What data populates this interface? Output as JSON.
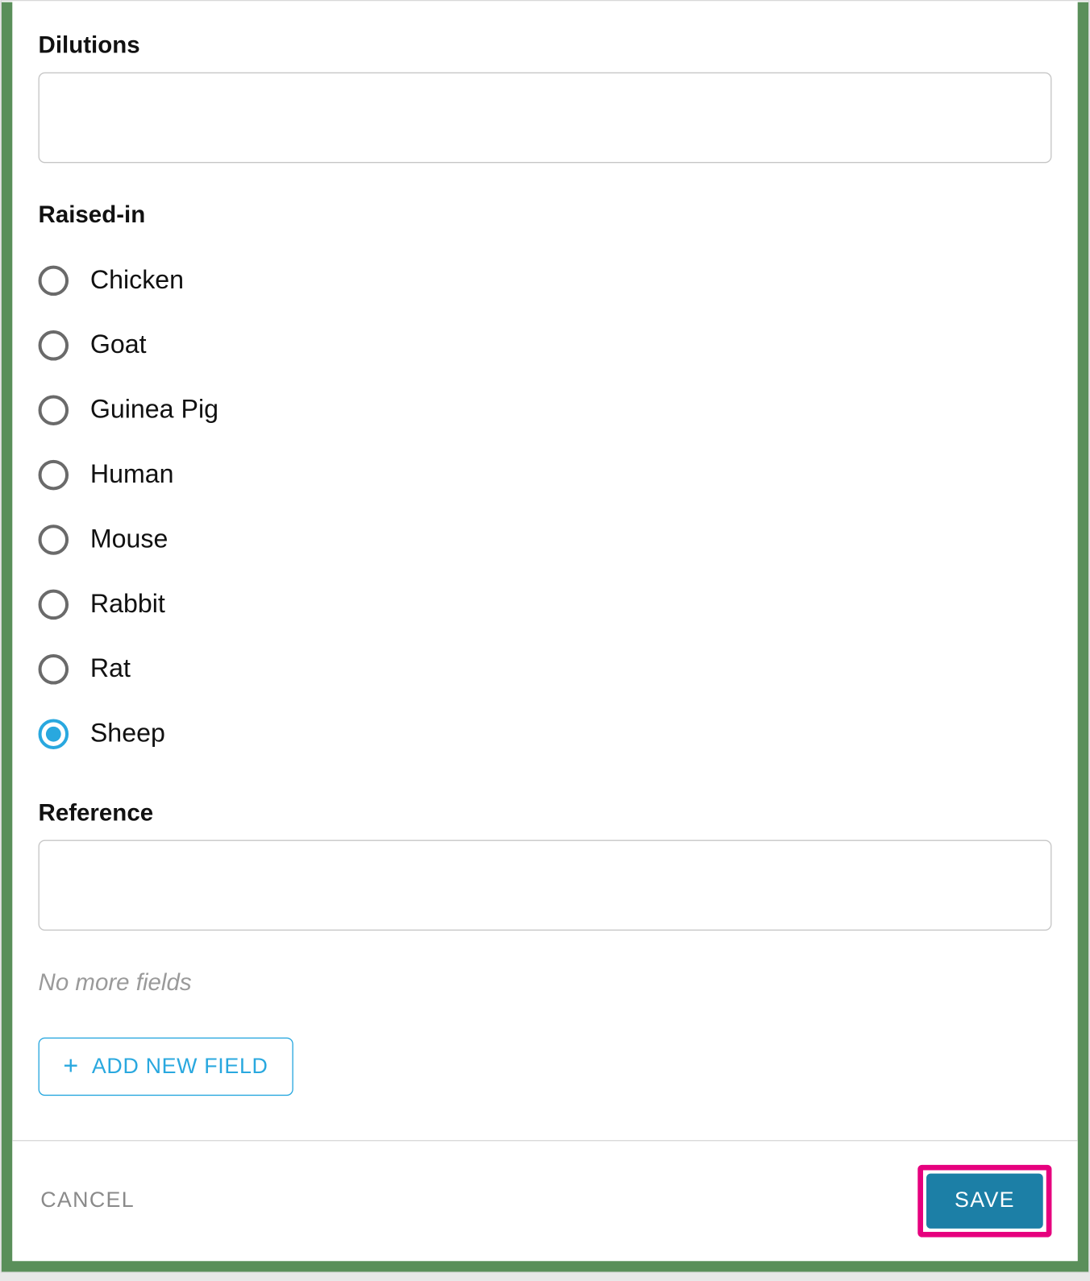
{
  "fields": {
    "dilutions": {
      "label": "Dilutions",
      "value": ""
    },
    "raised_in": {
      "label": "Raised-in",
      "options": [
        {
          "label": "Chicken",
          "selected": false
        },
        {
          "label": "Goat",
          "selected": false
        },
        {
          "label": "Guinea Pig",
          "selected": false
        },
        {
          "label": "Human",
          "selected": false
        },
        {
          "label": "Mouse",
          "selected": false
        },
        {
          "label": "Rabbit",
          "selected": false
        },
        {
          "label": "Rat",
          "selected": false
        },
        {
          "label": "Sheep",
          "selected": true
        }
      ]
    },
    "reference": {
      "label": "Reference",
      "value": ""
    }
  },
  "no_more_text": "No more fields",
  "add_field_label": "ADD NEW FIELD",
  "footer": {
    "cancel": "CANCEL",
    "save": "SAVE"
  }
}
